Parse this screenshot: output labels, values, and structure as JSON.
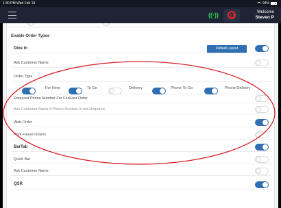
{
  "status_bar": {
    "time": "1:30 PM  Wed Feb 19",
    "battery": "94%"
  },
  "header": {
    "welcome": "Welcome",
    "user": "Steven P"
  },
  "section_title": "Enable Order Types",
  "dine_in": {
    "label": "Dine In",
    "default_layout_button": "Default Layout",
    "enabled": true
  },
  "ask_customer_name": {
    "label": "Ask Customer Name",
    "enabled": false
  },
  "order_type": {
    "title": "Order Type",
    "options": [
      {
        "label": "For Here",
        "on": true
      },
      {
        "label": "To Go",
        "on": true
      },
      {
        "label": "Delivery",
        "on": false
      },
      {
        "label": "Phone To Go",
        "on": true
      },
      {
        "label": "Phone Delivery",
        "on": true
      }
    ]
  },
  "required_phone": {
    "label": "Required Phone Number For ForHere Order",
    "enabled": false
  },
  "ask_name_if_phone": {
    "label": "Ask Customer Name If Phone Number Is not Required",
    "enabled": false
  },
  "web_order": {
    "label": "Web Order",
    "enabled": true
  },
  "print_future": {
    "label": "Print Future Orders",
    "enabled": false
  },
  "bartab": {
    "label": "BarTab",
    "enabled": true
  },
  "quick_bar": {
    "label": "Quick Bar",
    "enabled": false
  },
  "bar_ask_name": {
    "label": "Ask Customer Name",
    "enabled": false
  },
  "qsr": {
    "label": "QSR",
    "enabled": true
  },
  "colors": {
    "accent": "#2f6fb1",
    "header": "#1e2433",
    "annotation": "#d91f26"
  }
}
